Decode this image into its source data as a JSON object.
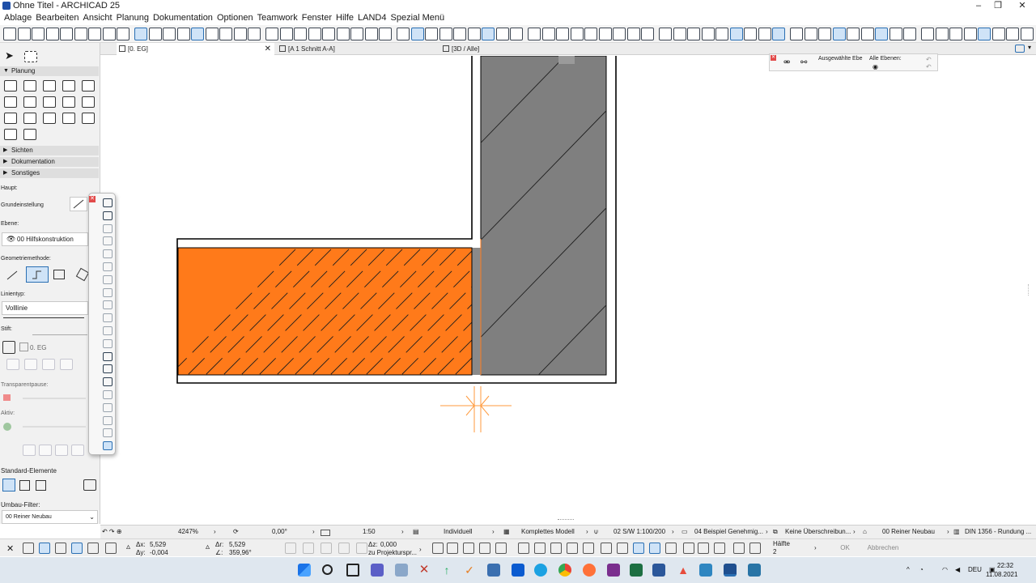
{
  "window": {
    "title": "Ohne Titel - ARCHICAD 25",
    "controls": [
      "–",
      "❐",
      "✕"
    ]
  },
  "menu": [
    "Ablage",
    "Bearbeiten",
    "Ansicht",
    "Planung",
    "Dokumentation",
    "Optionen",
    "Teamwork",
    "Fenster",
    "Hilfe",
    "LAND4",
    "Spezial Menü"
  ],
  "tabs": [
    {
      "label": "[0. EG]",
      "close": "✕"
    },
    {
      "label": "[A 1 Schnitt A-A]",
      "close": ""
    },
    {
      "label": "[3D / Alle]",
      "close": ""
    }
  ],
  "toolbox": {
    "sections": {
      "planung": "Planung",
      "sichten": "Sichten",
      "dokumentation": "Dokumentation",
      "sonstiges": "Sonstiges"
    },
    "info": {
      "haupt": "Haupt:",
      "grundeinstellung": "Grundeinstellung",
      "ebene_label": "Ebene:",
      "ebene_value": "00 Hilfskonstruktion",
      "geometrie_label": "Geometriemethode:",
      "linientyp_label": "Linientyp:",
      "linientyp_value": "Volllinie",
      "stift_label": "Stift:",
      "stift_value": "0. EG",
      "transparent_label": "Transparentpause:",
      "aktiv_label": "Aktiv:",
      "standard_label": "Standard-Elemente",
      "umbau_label": "Umbau-Filter:",
      "umbau_value": "00 Reiner Neubau"
    }
  },
  "layer_panel": {
    "selected": "Ausgewählte Ebe",
    "all": "Alle Ebenen:"
  },
  "statusbar": {
    "zoom": "4247%",
    "angle": "0,00°",
    "scale": "1:50",
    "struct_display": "Individuell",
    "model": "Komplettes Modell",
    "pen_set": "02 S/W 1:100/200",
    "mvo": "04 Beispiel Genehmig...",
    "override": "Keine Überschreibun...",
    "renovation": "00 Reiner Neubau",
    "dim": "DIN 1356 - Rundung ..."
  },
  "coords": {
    "x_label": "Δx:",
    "x_value": "5,529",
    "y_label": "Δy:",
    "y_value": "-0,004",
    "r_label": "Δr:",
    "r_value": "5,529",
    "a_label": "∠:",
    "a_value": "359,96°",
    "z_label": "Δz:",
    "z_value": "0,000",
    "z_ref": "zu Projekturspr...",
    "half": "Hälfte",
    "half_num": "2",
    "ok": "OK",
    "cancel": "Abbrechen"
  },
  "taskbar": {
    "lang": "DEU",
    "time": "22:32",
    "date": "11.08.2021"
  },
  "colors": {
    "insulation": "#ff7a1a",
    "concrete": "#7f7f7f",
    "accent": "#2a6fb3"
  }
}
